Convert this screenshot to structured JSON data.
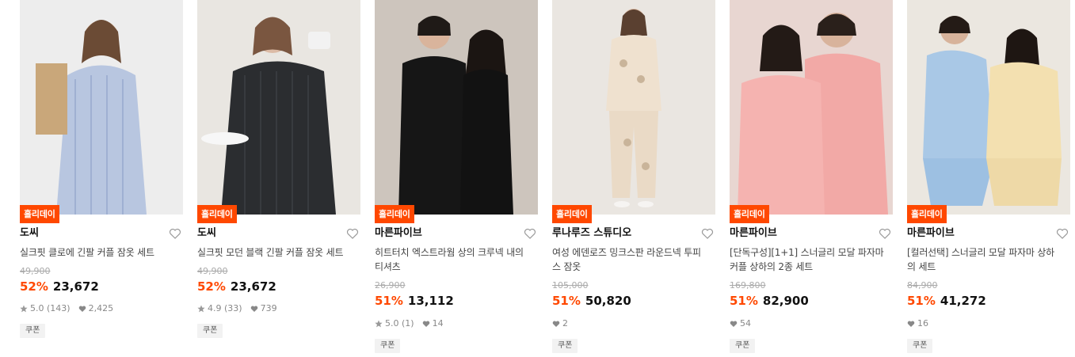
{
  "colors": {
    "accent": "#ff4800",
    "badge_bg": "#ff4800"
  },
  "products": [
    {
      "badge": "홀리데이",
      "brand": "도씨",
      "name": "실크핏 클로에 긴팔 커플 잠옷 세트",
      "original_price": "49,900",
      "discount": "52%",
      "price": "23,672",
      "rating": "5.0",
      "review_count": "(143)",
      "likes": "2,425",
      "coupon": "쿠폰",
      "image_icon": "pajama-photo",
      "tone": "#dfe3ea"
    },
    {
      "badge": "홀리데이",
      "brand": "도씨",
      "name": "실크핏 모던 블랙 긴팔 커플 잠옷 세트",
      "original_price": "49,900",
      "discount": "52%",
      "price": "23,672",
      "rating": "4.9",
      "review_count": "(33)",
      "likes": "739",
      "coupon": "쿠폰",
      "image_icon": "pajama-photo",
      "tone": "#e7e3dc"
    },
    {
      "badge": "홀리데이",
      "brand": "마른파이브",
      "name": "히트터치 엑스트라웜 상의 크루넥 내의 티셔츠",
      "original_price": "26,900",
      "discount": "51%",
      "price": "13,112",
      "rating": "5.0",
      "review_count": "(1)",
      "likes": "14",
      "coupon": "쿠폰",
      "image_icon": "thermal-photo",
      "tone": "#cfc8c0"
    },
    {
      "badge": "홀리데이",
      "brand": "루나루즈 스튜디오",
      "name": "여성 에덴로즈 밍크스판 라운드넥 투피스 잠옷",
      "original_price": "105,000",
      "discount": "51%",
      "price": "50,820",
      "rating": "",
      "review_count": "",
      "likes": "2",
      "coupon": "쿠폰",
      "image_icon": "pajama-photo",
      "tone": "#ebe7e2"
    },
    {
      "badge": "홀리데이",
      "brand": "마른파이브",
      "name": "[단독구성][1+1] 스너글리 모달 파자마 커플 상하의 2종 세트",
      "original_price": "169,800",
      "discount": "51%",
      "price": "82,900",
      "rating": "",
      "review_count": "",
      "likes": "54",
      "coupon": "쿠폰",
      "image_icon": "pajama-photo",
      "tone": "#e9d8d3"
    },
    {
      "badge": "홀리데이",
      "brand": "마른파이브",
      "name": "[컬러선택] 스너글리 모달 파자마 상하의 세트",
      "original_price": "84,900",
      "discount": "51%",
      "price": "41,272",
      "rating": "",
      "review_count": "",
      "likes": "16",
      "coupon": "쿠폰",
      "image_icon": "pajama-photo",
      "tone": "#ebe7e0"
    }
  ]
}
